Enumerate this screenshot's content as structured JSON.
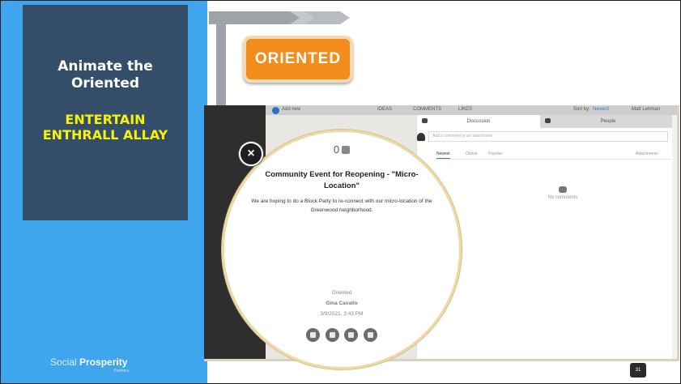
{
  "slide": {
    "title": "Animate the Oriented",
    "subtitle": "ENTERTAIN ENTHRALL ALLAY",
    "stage_button": "ORIENTED",
    "page_number": "31",
    "logo": {
      "word1": "Social",
      "word2": "Prosperity",
      "tagline": "Partners"
    }
  },
  "app": {
    "topbar": {
      "add_label": "Add new",
      "ideas": "IDEAS",
      "comments": "COMMENTS",
      "likes": "LIKES",
      "sort_label": "Sort by:",
      "sort_value": "Newest",
      "user": "Matt Lehman"
    },
    "tabs": [
      {
        "label": "Discussion"
      },
      {
        "label": "People"
      }
    ],
    "comment_placeholder": "Add a comment or an attachment",
    "sort_tabs": {
      "newest": "Newest",
      "oldest": "Oldest",
      "popular": "Popular",
      "attachments": "Attachments"
    },
    "no_comments": "No comments"
  },
  "post": {
    "likes": "0",
    "title": "Community Event for Reopening - \"Micro-Location\"",
    "body": "We are hoping to do a Block Party to re-connect with our micro-location of the Greenwood neighborhood.",
    "stage": "Oriented",
    "author": "Gina Cavallo",
    "timestamp": "3/9/2021, 3:43 PM",
    "actions": [
      "star-icon",
      "share-icon",
      "link-icon",
      "edit-icon"
    ]
  },
  "colors": {
    "accent_blue": "#3fa6ee",
    "title_box": "#344e6a",
    "highlight_yellow": "#f8f400",
    "stage_orange": "#f28c1b"
  }
}
